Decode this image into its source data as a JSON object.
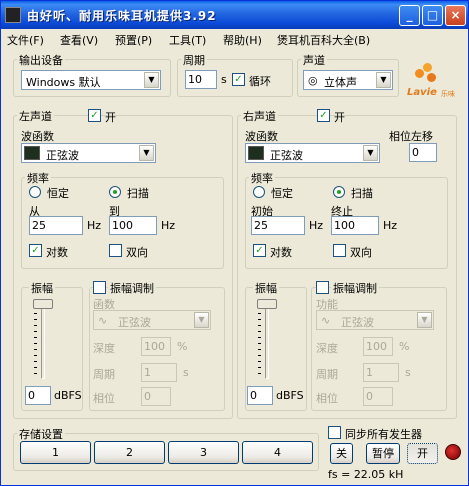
{
  "window": {
    "title": "由好听、耐用乐味耳机提供3.92",
    "min": "_",
    "max": "□",
    "close": "×"
  },
  "menu": [
    "文件(F)",
    "查看(V)",
    "预置(P)",
    "工具(T)",
    "帮助(H)",
    "煲耳机百科大全(B)"
  ],
  "output": {
    "label": "输出设备",
    "device": "Windows 默认"
  },
  "period": {
    "label": "周期",
    "value": "10",
    "unit": "s",
    "loop_label": "循环"
  },
  "channel": {
    "label": "声道",
    "value": "立体声"
  },
  "brand": {
    "name": "Lavie",
    "sub": "乐味"
  },
  "left": {
    "label": "左声道",
    "on_label": "开",
    "waveform_label": "波函数",
    "waveform": "正弦波",
    "freq_label": "频率",
    "constant": "恒定",
    "sweep": "扫描",
    "from_label": "从",
    "to_label": "到",
    "from": "25",
    "to": "100",
    "hz": "Hz",
    "log_label": "对数",
    "bidir_label": "双向",
    "amp_label": "振幅",
    "amp_value": "0",
    "dbfs": "dBFS",
    "mod_label": "振幅调制",
    "mod_func_label": "函数",
    "mod_wave": "正弦波",
    "depth_label": "深度",
    "depth": "100",
    "pct": "%",
    "mperiod_label": "周期",
    "mperiod": "1",
    "s": "s",
    "phase_label": "相位",
    "phase": "0"
  },
  "right": {
    "label": "右声道",
    "on_label": "开",
    "phase_shift_label": "相位左移",
    "phase_shift": "0",
    "waveform_label": "波函数",
    "waveform": "正弦波",
    "freq_label": "频率",
    "constant": "恒定",
    "sweep": "扫描",
    "from_label": "初始",
    "to_label": "终止",
    "from": "25",
    "to": "100",
    "hz": "Hz",
    "log_label": "对数",
    "bidir_label": "双向",
    "amp_label": "振幅",
    "amp_value": "0",
    "dbfs": "dBFS",
    "mod_label": "振幅调制",
    "mod_func_label": "功能",
    "mod_wave": "正弦波",
    "depth_label": "深度",
    "depth": "100",
    "pct": "%",
    "mperiod_label": "周期",
    "mperiod": "1",
    "s": "s",
    "phase_label": "相位",
    "phase": "0"
  },
  "storage": {
    "label": "存储设置",
    "slots": [
      "1",
      "2",
      "3",
      "4"
    ]
  },
  "sync": {
    "label": "同步所有发生器",
    "off": "关",
    "pause": "暂停",
    "on": "开"
  },
  "status": {
    "fs": "fs = 22.05 kH"
  }
}
